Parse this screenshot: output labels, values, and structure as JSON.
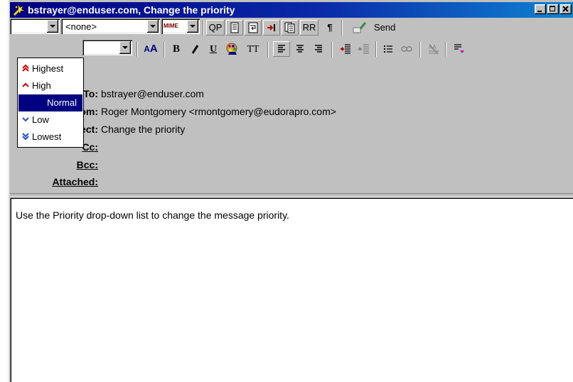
{
  "window": {
    "title": "bstrayer@enduser.com, Change the priority"
  },
  "toolbar1": {
    "priority_value": "",
    "signature_value": "<none>",
    "mime_label": "MIME",
    "qp_label": "QP",
    "rr_label": "RR",
    "send_label": "Send"
  },
  "toolbar2": {
    "bold_label": "B",
    "underline_label": "U",
    "tt_label": "TT"
  },
  "priority_menu": {
    "items": [
      {
        "label": "Highest",
        "icon": "double-up-arrow-icon"
      },
      {
        "label": "High",
        "icon": "up-arrow-icon"
      },
      {
        "label": "Normal",
        "icon": "none"
      },
      {
        "label": "Low",
        "icon": "down-arrow-icon"
      },
      {
        "label": "Lowest",
        "icon": "double-down-arrow-icon"
      }
    ],
    "selected": "Normal"
  },
  "header": {
    "to_label": "To:",
    "to_value": "bstrayer@enduser.com",
    "from_label": "From:",
    "from_value": "Roger Montgomery <rmontgomery@eudorapro.com>",
    "subject_label": "Subject:",
    "subject_value": "Change the priority",
    "cc_label": "Cc:",
    "bcc_label": "Bcc:",
    "attached_label": "Attached:"
  },
  "body": {
    "text": "Use the Priority drop-down list to change the message priority."
  },
  "colors": {
    "titlebar": "#000080",
    "selection": "#000080",
    "window_bg": "#c0c0c0"
  }
}
